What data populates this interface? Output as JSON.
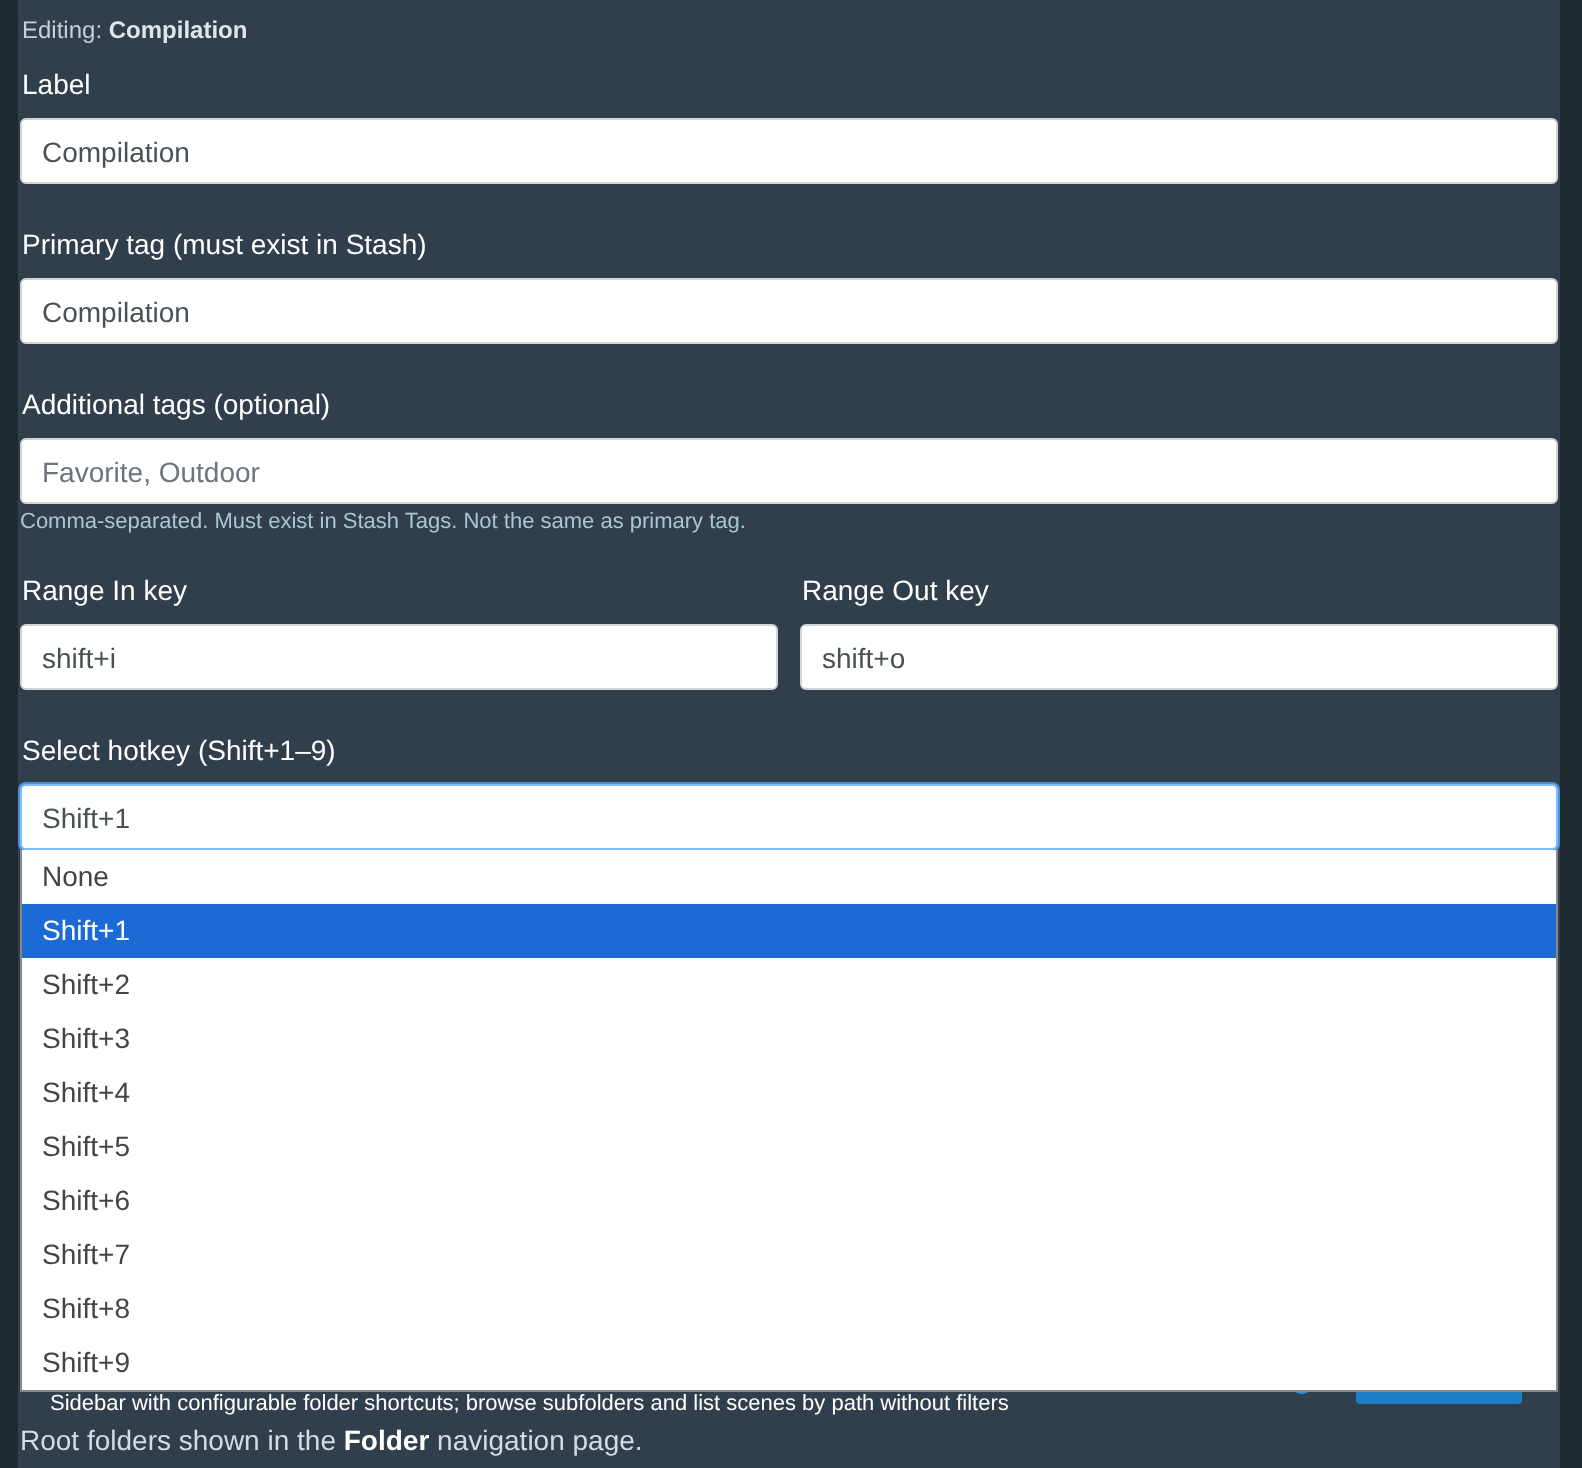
{
  "editing": "Editing: **Compilation**",
  "fields": [
    {
      "label": "Label",
      "value": "Compilation"
    },
    {
      "label": "Primary tag (must exist in Stash)",
      "value": "Compilation"
    },
    {
      "label": "Additional tags (optional)",
      "placeholder": "Favorite, Outdoor",
      "help": "Comma-separated. Must exist in Stash Tags. Not the same as primary tag."
    }
  ],
  "range_keys": [
    {
      "label": "Range In key",
      "value": "shift+i"
    },
    {
      "label": "Range Out key",
      "value": "shift+o"
    }
  ],
  "hotkey_select": {
    "label": "Select hotkey (Shift+1–9)",
    "value": "Shift+1",
    "expanded": true,
    "options": [
      {
        "label": "None",
        "selected": false
      },
      {
        "label": "Shift+1",
        "selected": true
      },
      {
        "label": "Shift+2",
        "selected": false
      },
      {
        "label": "Shift+3",
        "selected": false
      },
      {
        "label": "Shift+4",
        "selected": false
      },
      {
        "label": "Shift+5",
        "selected": false
      },
      {
        "label": "Shift+6",
        "selected": false
      },
      {
        "label": "Shift+7",
        "selected": false
      },
      {
        "label": "Shift+8",
        "selected": false
      },
      {
        "label": "Shift+9",
        "selected": false
      }
    ]
  },
  "plugin_row": {
    "description": "Sidebar with configurable folder shortcuts; browse subfolders and list scenes by path without filters"
  },
  "footer_note": "Root folders shown in the **Folder** navigation page."
}
